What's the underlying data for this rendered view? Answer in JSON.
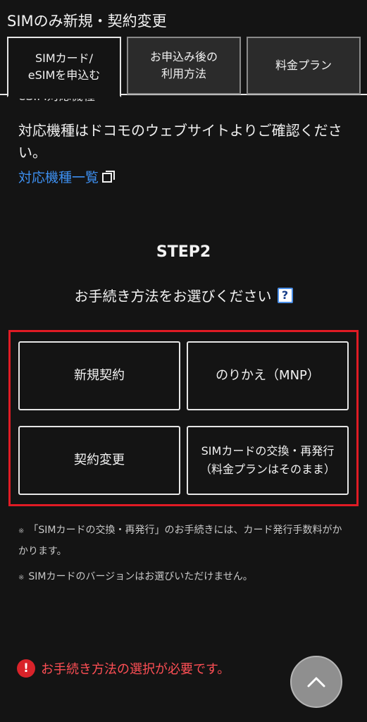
{
  "header": {
    "title": "SIMのみ新規・契約変更",
    "tabs": [
      {
        "label": "SIMカード/\neSIMを申込む",
        "active": true
      },
      {
        "label": "お申込み後の\n利用方法",
        "active": false
      },
      {
        "label": "料金プラン",
        "active": false
      }
    ]
  },
  "device_section": {
    "cut_label": "eSIM対応機種",
    "text": "対応機種はドコモのウェブサイトよりご確認ください。",
    "link_label": "対応機種一覧",
    "link_icon": "external-link-icon"
  },
  "step": {
    "label": "STEP2",
    "question": "お手続き方法をお選びください",
    "help_icon": "question-icon",
    "options": [
      {
        "label": "新規契約"
      },
      {
        "label": "のりかえ（MNP）"
      },
      {
        "label": "契約変更"
      },
      {
        "label": "SIMカードの交換・再発行\n（料金プランはそのまま）"
      }
    ],
    "frame_color": "#e01b24"
  },
  "notes": [
    {
      "mark": "※",
      "text": "「SIMカードの交換・再発行」のお手続きには、カード発行手数料がかかります。"
    },
    {
      "mark": "※",
      "text": "SIMカードのバージョンはお選びいただけません。"
    }
  ],
  "error": {
    "icon": "!",
    "text": "お手続き方法の選択が必要です。",
    "color": "#ff4f55"
  },
  "scroll_top": {
    "icon": "chevron-up-icon"
  },
  "colors": {
    "background": "#141414",
    "link": "#3d8ff0",
    "accent_red": "#e01b24"
  }
}
